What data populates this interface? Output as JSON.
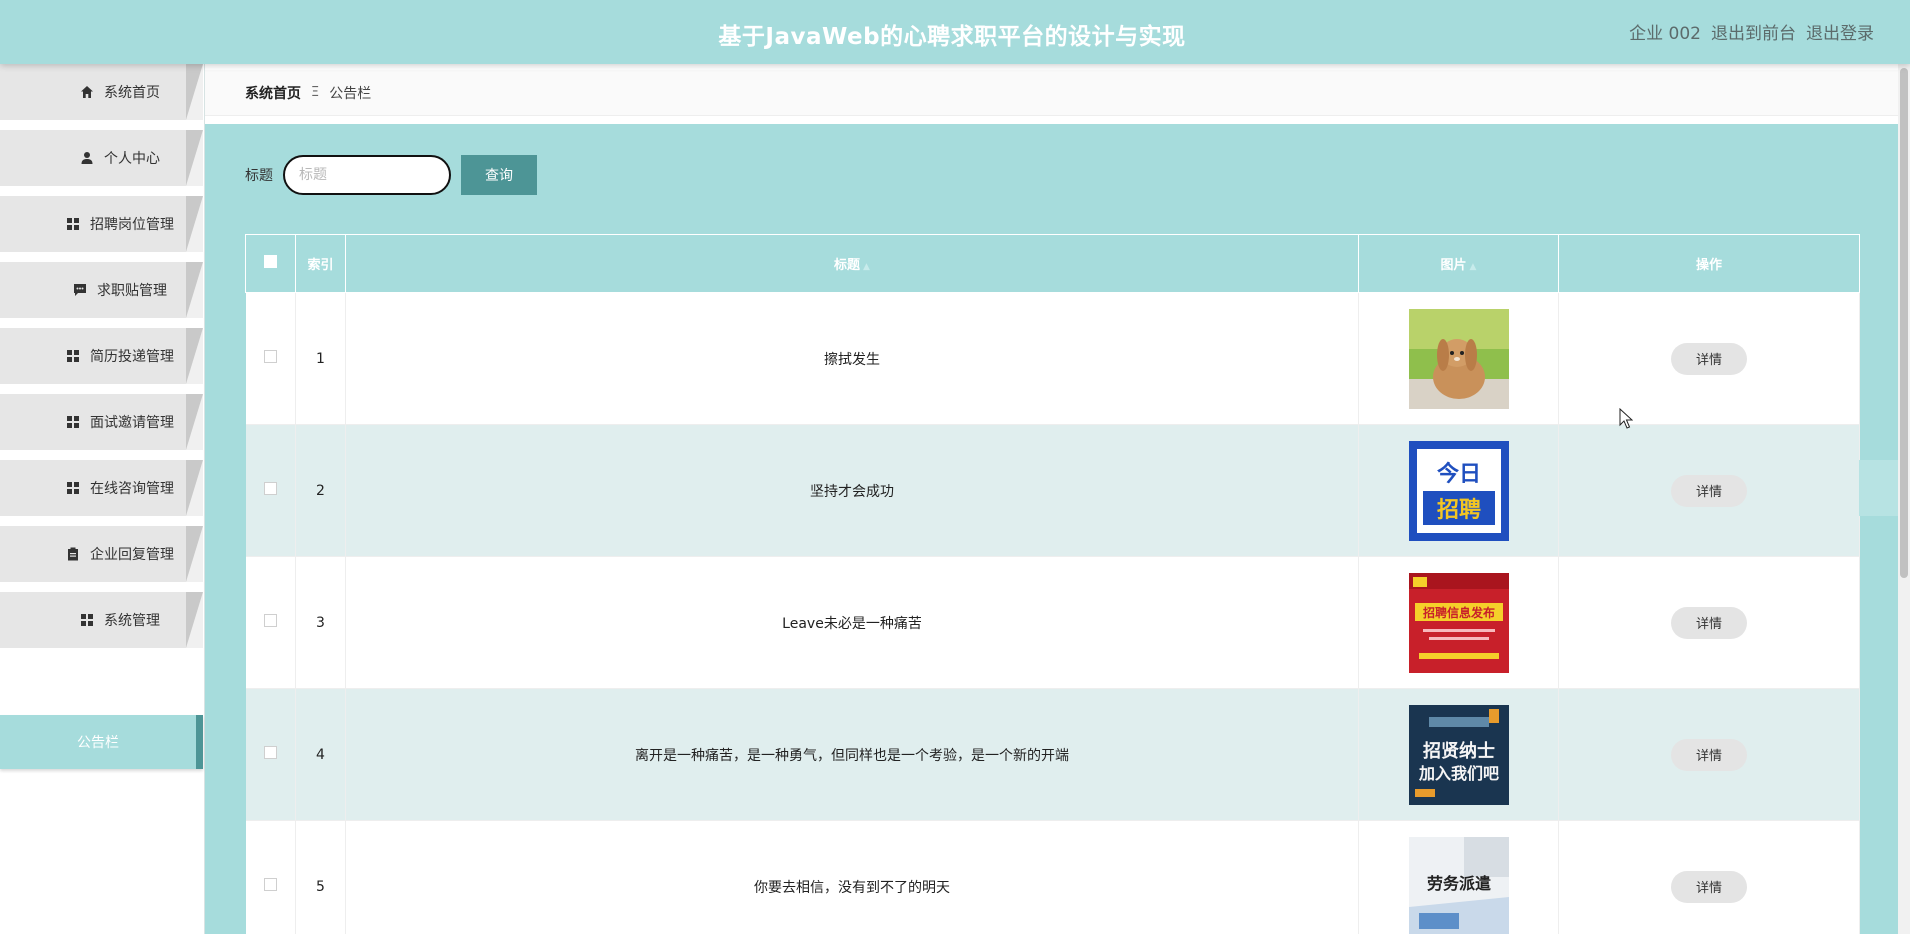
{
  "header": {
    "title": "基于JavaWeb的心聘求职平台的设计与实现",
    "user": "企业 002",
    "to_front": "退出到前台",
    "logout": "退出登录"
  },
  "sidebar": {
    "items": [
      {
        "label": "系统首页",
        "icon": "home-icon"
      },
      {
        "label": "个人中心",
        "icon": "user-icon"
      },
      {
        "label": "招聘岗位管理",
        "icon": "grid-icon"
      },
      {
        "label": "求职贴管理",
        "icon": "chat-icon"
      },
      {
        "label": "简历投递管理",
        "icon": "grid-icon"
      },
      {
        "label": "面试邀请管理",
        "icon": "grid-icon"
      },
      {
        "label": "在线咨询管理",
        "icon": "grid-icon"
      },
      {
        "label": "企业回复管理",
        "icon": "clipboard-icon"
      },
      {
        "label": "系统管理",
        "icon": "grid-icon"
      }
    ],
    "active_sub": "公告栏"
  },
  "breadcrumb": {
    "home": "系统首页",
    "sep": "Ξ",
    "current": "公告栏"
  },
  "search": {
    "label": "标题",
    "placeholder": "标题",
    "button": "查询"
  },
  "table": {
    "headers": {
      "index": "索引",
      "title": "标题",
      "image": "图片",
      "action": "操作"
    },
    "rows": [
      {
        "index": "1",
        "title": "擦拭发生",
        "image": "rabbit-photo",
        "action": "详情"
      },
      {
        "index": "2",
        "title": "坚持才会成功",
        "image": "recruit-poster-blue",
        "image_text": "今日招聘",
        "action": "详情"
      },
      {
        "index": "3",
        "title": "Leave未必是一种痛苦",
        "image": "recruit-poster-red",
        "image_text": "招聘信息发布",
        "action": "详情"
      },
      {
        "index": "4",
        "title": "离开是一种痛苦，是一种勇气，但同样也是一个考验，是一个新的开端",
        "image": "recruit-poster-navy",
        "image_text": "招贤纳士 加入我们吧",
        "action": "详情"
      },
      {
        "index": "5",
        "title": "你要去相信，没有到不了的明天",
        "image": "labor-dispatch-photo",
        "image_text": "劳务派遣",
        "action": "详情"
      }
    ]
  },
  "colors": {
    "accent": "#a6dcdc",
    "accent_dark": "#4d9596",
    "row_alt": "#e0eeee"
  }
}
